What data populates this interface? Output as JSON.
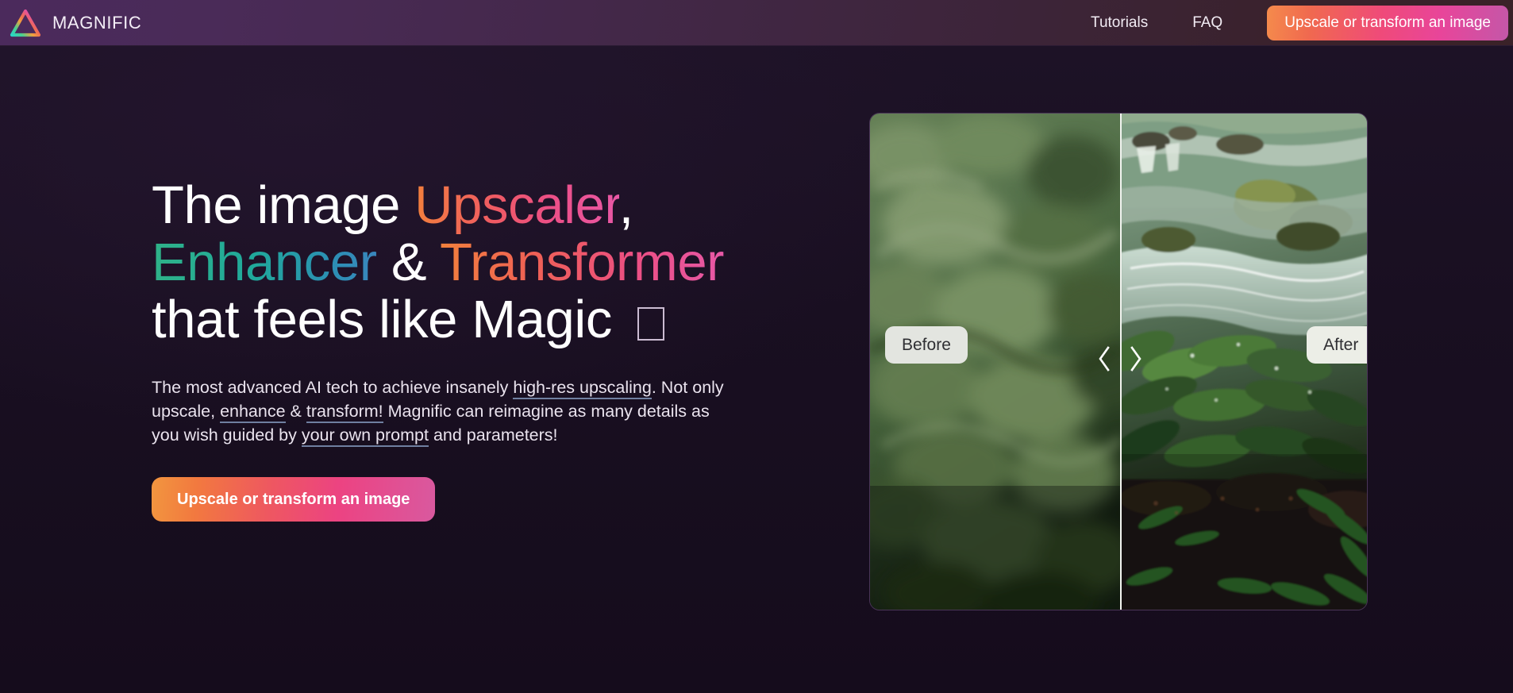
{
  "header": {
    "brand_name": "MAGNIFIC",
    "logo_icon": "triangle-gradient-logo-icon",
    "nav": [
      {
        "label": "Tutorials",
        "name": "nav-link-tutorials"
      },
      {
        "label": "FAQ",
        "name": "nav-link-faq"
      }
    ],
    "cta_label": "Upscale or transform an image"
  },
  "hero": {
    "headline": {
      "line1_plain": "The image ",
      "line1_accent": "Upscaler",
      "line1_tail": ",",
      "line2_accent_a": "Enhancer",
      "line2_amp": " & ",
      "line2_accent_b": "Transformer",
      "line3": "that feels like Magic ",
      "line3_emoji": "missing-glyph-box"
    },
    "paragraph": {
      "seg1": "The most advanced AI tech to achieve insanely ",
      "link1": "high-res upscaling",
      "seg2": ". Not only upscale, ",
      "link2": "enhance",
      "seg3": " & ",
      "link3": "transform!",
      "seg4": " Magnific can reimagine as many details as you wish guided by ",
      "link4": "your own prompt",
      "seg5": " and parameters!"
    },
    "cta_label": "Upscale or transform an image"
  },
  "compare": {
    "before_label": "Before",
    "after_label": "After",
    "prev_icon": "chevron-left-icon",
    "next_icon": "chevron-right-icon",
    "before_alt": "blurry low-resolution green foliage photo",
    "after_alt": "sharp high-resolution waterfall and rainforest foliage photo"
  },
  "colors": {
    "accent_orange": "#f2803c",
    "accent_pink": "#ec4f86",
    "accent_magenta": "#e858a6",
    "accent_green": "#2fb288",
    "accent_blue": "#3a86bd",
    "page_bg": "#190f21",
    "header_left": "#4b2a5c",
    "header_right": "#3a2228",
    "link_underline": "#6f7fa0"
  }
}
